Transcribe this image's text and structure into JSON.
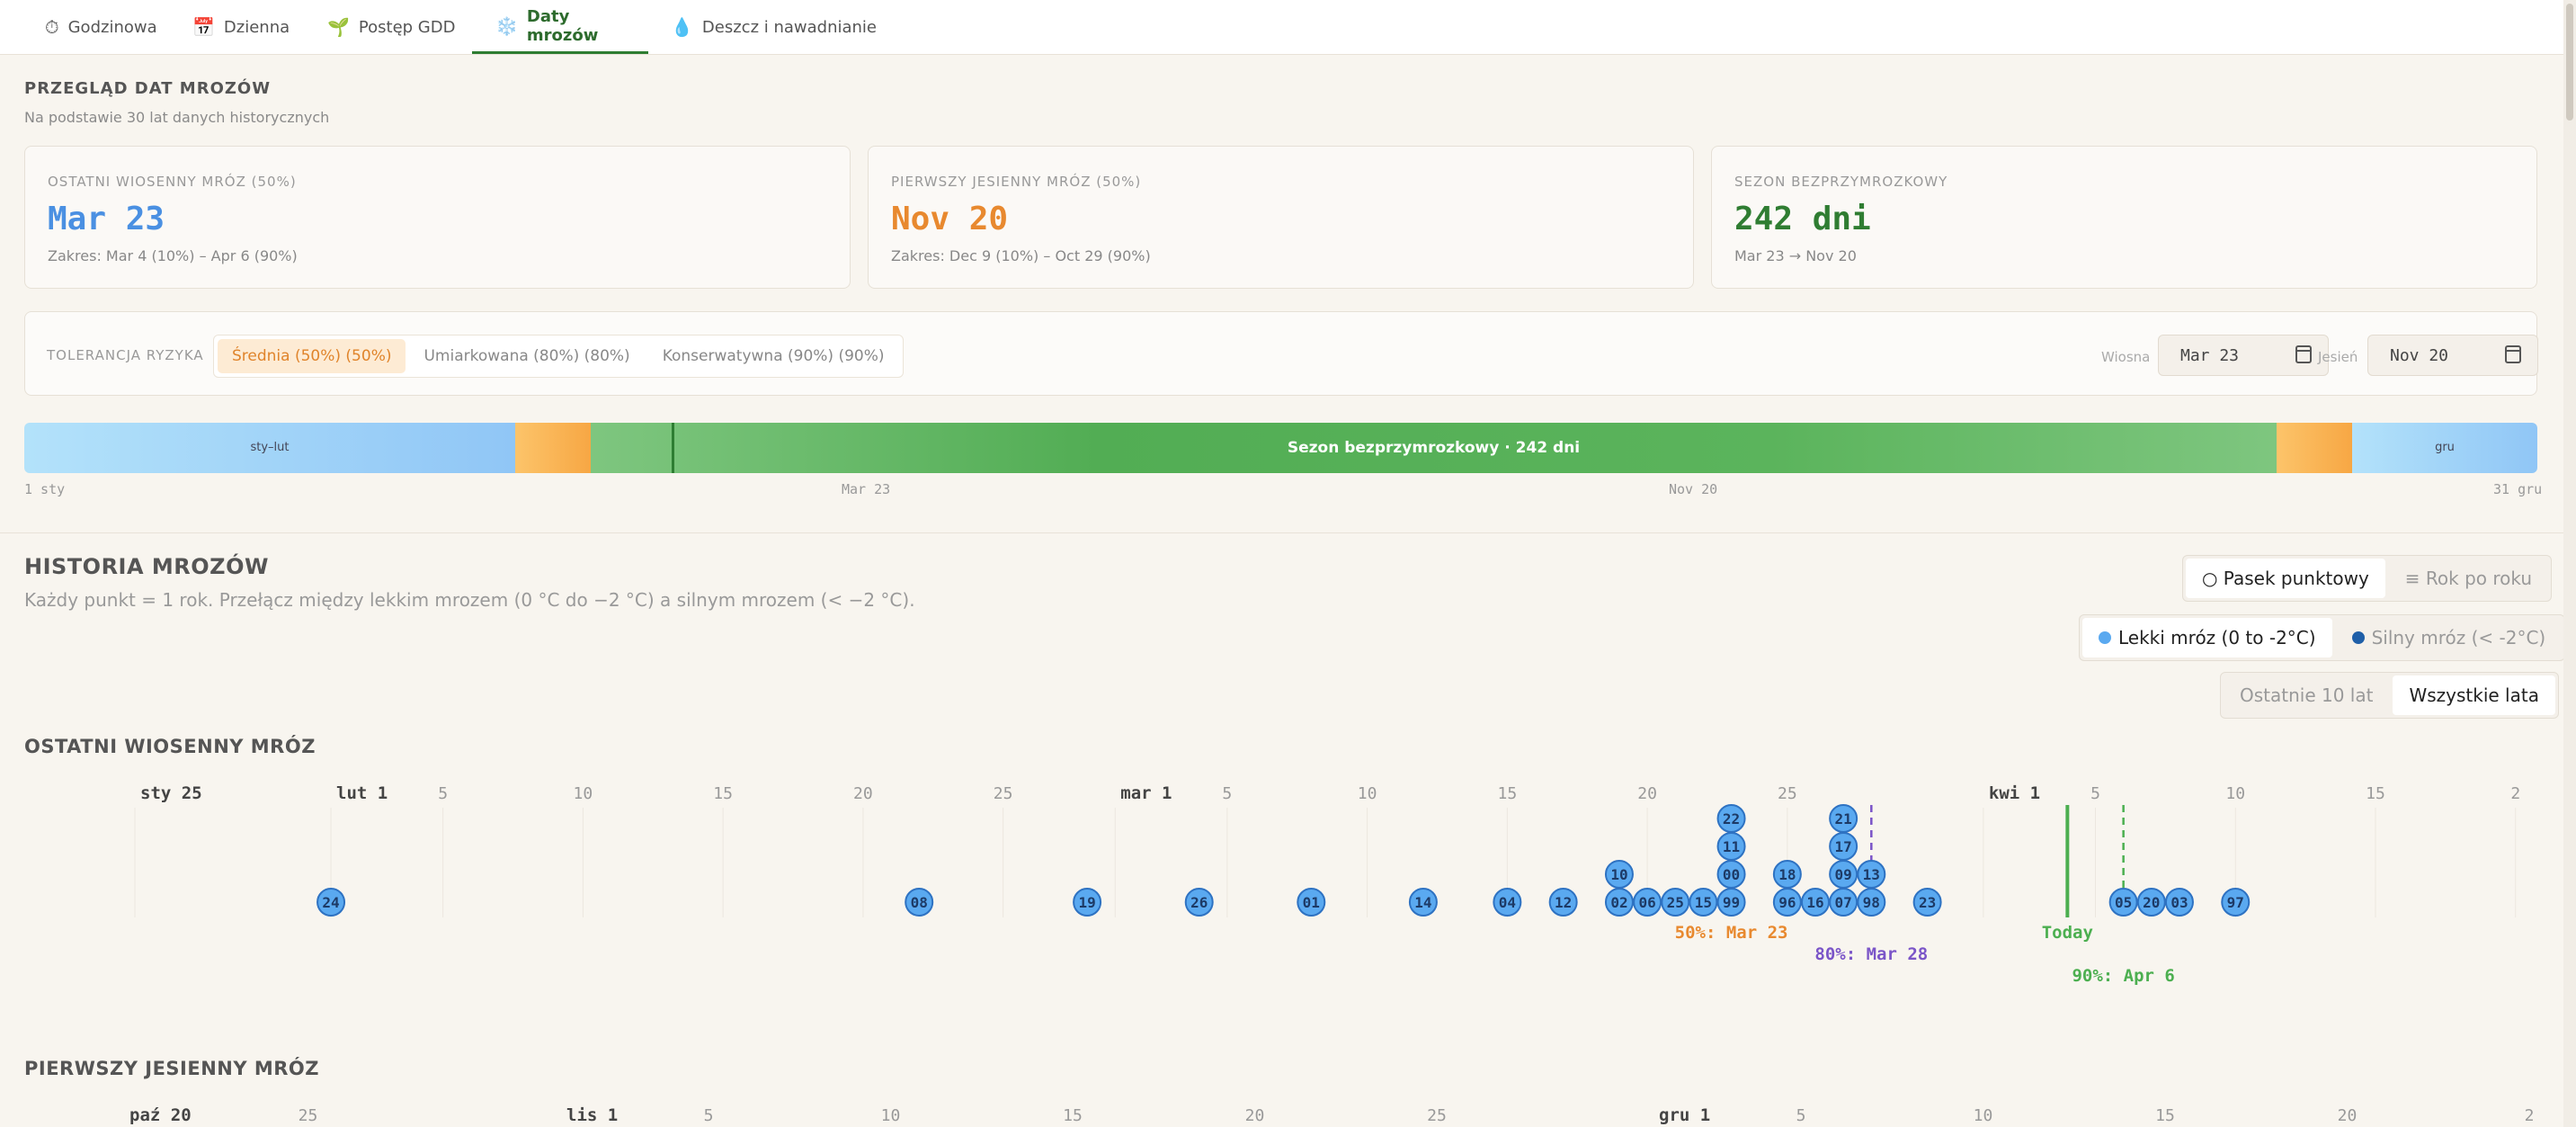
{
  "tabs": [
    {
      "icon": "⏱",
      "label": "Godzinowa",
      "active": false
    },
    {
      "icon": "📅",
      "label": "Dzienna",
      "active": false
    },
    {
      "icon": "🌱",
      "label": "Postęp GDD",
      "active": false
    },
    {
      "icon": "❄️",
      "label": "Daty mrozów",
      "active": true
    },
    {
      "icon": "💧",
      "label": "Deszcz i nawadnianie",
      "active": false
    }
  ],
  "overview": {
    "title": "PRZEGLĄD DAT MROZÓW",
    "subtitle": "Na podstawie 30 lat danych historycznych",
    "cards": [
      {
        "label": "OSTATNI WIOSENNY MRÓZ (50%)",
        "value": "Mar 23",
        "range": "Zakres: Mar 4 (10%) – Apr 6 (90%)",
        "color": "#4a90e2"
      },
      {
        "label": "PIERWSZY JESIENNY MRÓZ (50%)",
        "value": "Nov 20",
        "range": "Zakres: Dec 9 (10%) – Oct 29 (90%)",
        "color": "#e8892f"
      },
      {
        "label": "SEZON BEZPRZYMROZKOWY",
        "value": "242 dni",
        "range": "Mar 23 → Nov 20",
        "color": "#2f7d32"
      }
    ]
  },
  "risk": {
    "label": "TOLERANCJA RYZYKA",
    "options": [
      "Średnia (50%) (50%)",
      "Umiarkowana (80%) (80%)",
      "Konserwatywna (90%) (90%)"
    ],
    "selected": 0,
    "spring_label": "Wiosna",
    "spring_value": "Mar 23",
    "autumn_label": "Jesień",
    "autumn_value": "Nov 20"
  },
  "season_bar": {
    "winter_start_label": "sty–lut",
    "season_label": "Sezon bezprzymrozkowy · 242 dni",
    "winter_end_label": "gru",
    "axis": [
      "1 sty",
      "Mar 23",
      "Nov 20",
      "31 gru"
    ]
  },
  "history": {
    "title": "HISTORIA MROZÓW",
    "subtitle": "Każdy punkt = 1 rok. Przełącz między lekkim mrozem (0 °C do −2 °C) a silnym mrozem (< −2 °C).",
    "view_options": [
      "○ Pasek punktowy",
      "≡ Rok po roku"
    ],
    "view_selected": 0,
    "frost_options": [
      "Lekki mróz (0 to -2°C)",
      "Silny mróz (< -2°C)"
    ],
    "frost_colors": [
      "#5aa9f0",
      "#1f5fa8"
    ],
    "frost_selected": 0,
    "range_options": [
      "Ostatnie 10 lat",
      "Wszystkie lata"
    ],
    "range_selected": 1
  },
  "spring_timeline": {
    "title": "OSTATNI WIOSENNY MRÓZ",
    "start_date": "2025-01-25",
    "ticks": [
      {
        "day": 0,
        "label": "sty 25",
        "month": true
      },
      {
        "day": 7,
        "label": "lut 1",
        "month": true
      },
      {
        "day": 11,
        "label": "5"
      },
      {
        "day": 16,
        "label": "10"
      },
      {
        "day": 21,
        "label": "15"
      },
      {
        "day": 26,
        "label": "20"
      },
      {
        "day": 31,
        "label": "25"
      },
      {
        "day": 35,
        "label": "mar 1",
        "month": true
      },
      {
        "day": 39,
        "label": "5"
      },
      {
        "day": 44,
        "label": "10"
      },
      {
        "day": 49,
        "label": "15"
      },
      {
        "day": 54,
        "label": "20"
      },
      {
        "day": 59,
        "label": "25"
      },
      {
        "day": 66,
        "label": "kwi 1",
        "month": true
      },
      {
        "day": 70,
        "label": "5"
      },
      {
        "day": 75,
        "label": "10"
      },
      {
        "day": 80,
        "label": "15"
      },
      {
        "day": 85,
        "label": "2"
      }
    ],
    "years": [
      {
        "day": 7,
        "level": 0,
        "label": "24"
      },
      {
        "day": 28,
        "level": 0,
        "label": "08"
      },
      {
        "day": 34,
        "level": 0,
        "label": "19"
      },
      {
        "day": 38,
        "level": 0,
        "label": "26"
      },
      {
        "day": 42,
        "level": 0,
        "label": "01"
      },
      {
        "day": 46,
        "level": 0,
        "label": "14"
      },
      {
        "day": 49,
        "level": 0,
        "label": "04"
      },
      {
        "day": 51,
        "level": 0,
        "label": "12"
      },
      {
        "day": 53,
        "level": 0,
        "label": "02"
      },
      {
        "day": 53,
        "level": 1,
        "label": "10"
      },
      {
        "day": 54,
        "level": 0,
        "label": "06"
      },
      {
        "day": 55,
        "level": 0,
        "label": "25"
      },
      {
        "day": 56,
        "level": 0,
        "label": "15"
      },
      {
        "day": 57,
        "level": 0,
        "label": "99"
      },
      {
        "day": 57,
        "level": 1,
        "label": "00"
      },
      {
        "day": 57,
        "level": 2,
        "label": "11"
      },
      {
        "day": 57,
        "level": 3,
        "label": "22"
      },
      {
        "day": 59,
        "level": 0,
        "label": "96"
      },
      {
        "day": 59,
        "level": 1,
        "label": "18"
      },
      {
        "day": 60,
        "level": 0,
        "label": "16"
      },
      {
        "day": 61,
        "level": 0,
        "label": "07"
      },
      {
        "day": 61,
        "level": 1,
        "label": "09"
      },
      {
        "day": 61,
        "level": 2,
        "label": "17"
      },
      {
        "day": 61,
        "level": 3,
        "label": "21"
      },
      {
        "day": 62,
        "level": 0,
        "label": "98"
      },
      {
        "day": 62,
        "level": 1,
        "label": "13"
      },
      {
        "day": 64,
        "level": 0,
        "label": "23"
      },
      {
        "day": 71,
        "level": 0,
        "label": "05"
      },
      {
        "day": 72,
        "level": 0,
        "label": "20"
      },
      {
        "day": 73,
        "level": 0,
        "label": "03"
      },
      {
        "day": 75,
        "level": 0,
        "label": "97"
      }
    ],
    "markers": [
      {
        "day": 57,
        "label": "50%: Mar 23",
        "color": "#e8892f",
        "style": "none",
        "row": 0
      },
      {
        "day": 62,
        "label": "80%: Mar 28",
        "color": "#7b55c8",
        "style": "dashed",
        "row": 1
      },
      {
        "day": 69,
        "label": "Today",
        "color": "#4caf50",
        "style": "solid",
        "row": 0
      },
      {
        "day": 71,
        "label": "90%: Apr 6",
        "color": "#4caf50",
        "style": "dashed",
        "row": 2
      }
    ]
  },
  "autumn_timeline": {
    "title": "PIERWSZY JESIENNY MRÓZ",
    "ticks": [
      {
        "day": 0,
        "label": "paź 20",
        "month": true
      },
      {
        "day": 5,
        "label": "25"
      },
      {
        "day": 12,
        "label": "lis 1",
        "month": true
      },
      {
        "day": 16,
        "label": "5"
      },
      {
        "day": 21,
        "label": "10"
      },
      {
        "day": 26,
        "label": "15"
      },
      {
        "day": 31,
        "label": "20"
      },
      {
        "day": 36,
        "label": "25"
      },
      {
        "day": 42,
        "label": "gru 1",
        "month": true
      },
      {
        "day": 46,
        "label": "5"
      },
      {
        "day": 51,
        "label": "10"
      },
      {
        "day": 56,
        "label": "15"
      },
      {
        "day": 61,
        "label": "20"
      },
      {
        "day": 66,
        "label": "2"
      }
    ]
  }
}
